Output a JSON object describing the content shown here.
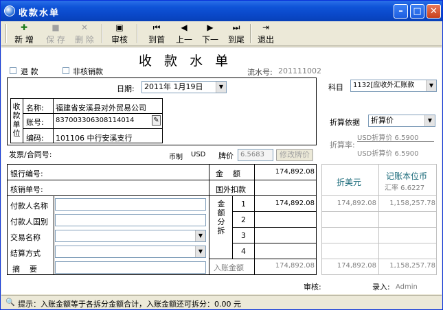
{
  "window": {
    "title": "收款水单"
  },
  "toolbar": {
    "new": "新 增",
    "save": "保 存",
    "delete": "删 除",
    "audit": "审核",
    "first": "到首",
    "prev": "上一",
    "next": "下一",
    "last": "到尾",
    "exit": "退出"
  },
  "form": {
    "heading": "收 款 水 单",
    "chk_return": "退 款",
    "chk_nonaudit": "非核销款",
    "serial_label": "流水号:",
    "serial_value": "201111002",
    "date_label": "日期:",
    "date_value": "2011年 1月19日",
    "payee_label": "收款单位",
    "name_label": "名称:",
    "name_value": "福建省安溪县对外贸易公司",
    "acct_label": "账号:",
    "acct_value": "837003306308114014",
    "code_label": "编码:",
    "code_value": "101106  中行安溪支行",
    "invoice_label": "发票/合同号:",
    "currency_label": "币制",
    "currency_value": "USD",
    "price_label": "牌价",
    "price_value": "6.5683",
    "price_btn": "修改牌价",
    "bank_no_label": "银行编号:",
    "verify_no_label": "核销单号:",
    "payer_name_label": "付款人名称",
    "payer_country_label": "付款人国别",
    "trade_label": "交易名称",
    "settle_label": "结算方式",
    "remark_label": "摘    要",
    "amount_label": "金    额",
    "amount_value": "174,892.08",
    "foreign_deduct_label": "国外扣款",
    "split_label": "金额分拆",
    "split_rows": [
      {
        "no": "1",
        "value": "174,892.08"
      },
      {
        "no": "2",
        "value": ""
      },
      {
        "no": "3",
        "value": ""
      },
      {
        "no": "4",
        "value": ""
      }
    ],
    "entry_amount_label": "入账金额",
    "entry_amount_value": "174,892.08",
    "subject_label": "科目",
    "subject_value": "1132[应收外汇账款",
    "convert_basis_label": "折算依据",
    "convert_basis_value": "折算价",
    "convert_rate_label": "折算率:",
    "rate_line1": "USD折算价 6.5900",
    "rate_line2": "USD折算价 6.5900",
    "usd_col": "折美元",
    "rmb_col": "记账本位币",
    "rmb_rate": "汇率 6.6227",
    "usd_values": [
      "174,892.08",
      "",
      "",
      "",
      "174,892.08"
    ],
    "rmb_values": [
      "1,158,257.78",
      "",
      "",
      "",
      "1,158,257.78"
    ],
    "audit_label": "审核:",
    "entry_label": "录入:",
    "entry_value": "Admin"
  },
  "status": {
    "text": "提示：入账金额等于各拆分金额合计，入账金额还可拆分：0.00 元"
  }
}
